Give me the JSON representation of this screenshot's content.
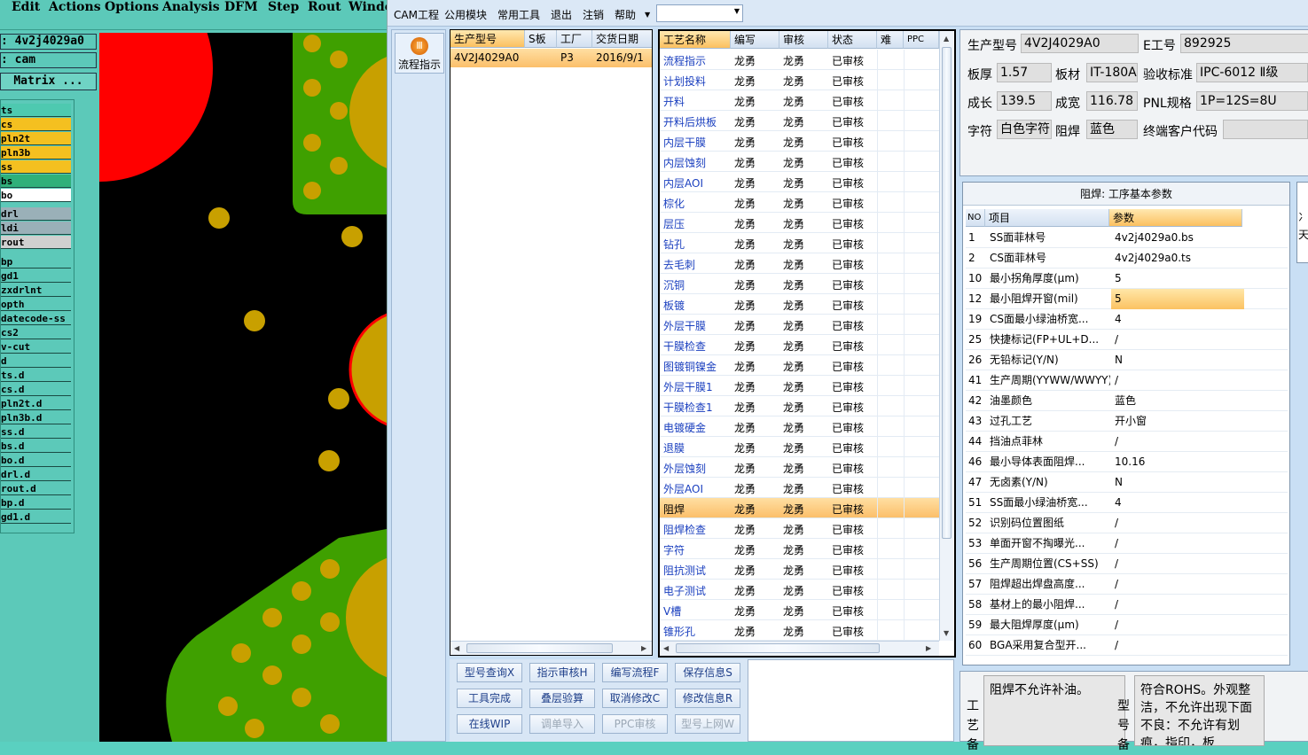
{
  "genesis": {
    "menu": [
      "Edit",
      "Actions",
      "Options",
      "Analysis",
      "DFM",
      "Step",
      "Rout",
      "Windo"
    ],
    "job": ": 4v2j4029a0",
    "step": ": cam",
    "matrix": "Matrix ...",
    "layers": [
      "ts",
      "cs",
      "pln2t",
      "pln3b",
      "ss",
      "bs",
      "bo",
      "drl",
      "ldi",
      "rout",
      "bp",
      "gd1",
      "zxdrlnt",
      "opth",
      "datecode-ss",
      "cs2",
      "v-cut",
      "d",
      "ts.d",
      "cs.d",
      "pln2t.d",
      "pln3b.d",
      "ss.d",
      "bs.d",
      "bo.d",
      "drl.d",
      "rout.d",
      "bp.d",
      "gd1.d"
    ],
    "colors": {
      "bg": "#5cc9b9",
      "copper": "#c8a000",
      "mask": "#3fa000",
      "red": "#ff0000",
      "board": "#000000"
    }
  },
  "app": {
    "menu": [
      "CAM工程",
      "公用模块",
      "常用工具",
      "退出",
      "注销",
      "帮助"
    ],
    "nav": {
      "flow_button": "流程指示",
      "icon": "flow-icon"
    },
    "orders": {
      "headers": [
        "生产型号",
        "S板",
        "工厂",
        "交货日期"
      ],
      "rows": [
        [
          "4V2J4029A0",
          "",
          "P3",
          "2016/9/1"
        ]
      ]
    },
    "processes": {
      "headers": [
        "工艺名称",
        "编写",
        "审核",
        "状态",
        "难",
        "PPC"
      ],
      "rows": [
        [
          "流程指示",
          "龙勇",
          "龙勇",
          "已审核"
        ],
        [
          "计划投料",
          "龙勇",
          "龙勇",
          "已审核"
        ],
        [
          "开料",
          "龙勇",
          "龙勇",
          "已审核"
        ],
        [
          "开料后烘板",
          "龙勇",
          "龙勇",
          "已审核"
        ],
        [
          "内层干膜",
          "龙勇",
          "龙勇",
          "已审核"
        ],
        [
          "内层蚀刻",
          "龙勇",
          "龙勇",
          "已审核"
        ],
        [
          "内层AOI",
          "龙勇",
          "龙勇",
          "已审核"
        ],
        [
          "棕化",
          "龙勇",
          "龙勇",
          "已审核"
        ],
        [
          "层压",
          "龙勇",
          "龙勇",
          "已审核"
        ],
        [
          "钻孔",
          "龙勇",
          "龙勇",
          "已审核"
        ],
        [
          "去毛刺",
          "龙勇",
          "龙勇",
          "已审核"
        ],
        [
          "沉铜",
          "龙勇",
          "龙勇",
          "已审核"
        ],
        [
          "板镀",
          "龙勇",
          "龙勇",
          "已审核"
        ],
        [
          "外层干膜",
          "龙勇",
          "龙勇",
          "已审核"
        ],
        [
          "干膜检查",
          "龙勇",
          "龙勇",
          "已审核"
        ],
        [
          "图镀铜镍金",
          "龙勇",
          "龙勇",
          "已审核"
        ],
        [
          "外层干膜1",
          "龙勇",
          "龙勇",
          "已审核"
        ],
        [
          "干膜检查1",
          "龙勇",
          "龙勇",
          "已审核"
        ],
        [
          "电镀硬金",
          "龙勇",
          "龙勇",
          "已审核"
        ],
        [
          "退膜",
          "龙勇",
          "龙勇",
          "已审核"
        ],
        [
          "外层蚀刻",
          "龙勇",
          "龙勇",
          "已审核"
        ],
        [
          "外层AOI",
          "龙勇",
          "龙勇",
          "已审核"
        ],
        [
          "阻焊",
          "龙勇",
          "龙勇",
          "已审核"
        ],
        [
          "阻焊检查",
          "龙勇",
          "龙勇",
          "已审核"
        ],
        [
          "字符",
          "龙勇",
          "龙勇",
          "已审核"
        ],
        [
          "阻抗测试",
          "龙勇",
          "龙勇",
          "已审核"
        ],
        [
          "电子测试",
          "龙勇",
          "龙勇",
          "已审核"
        ],
        [
          "V槽",
          "龙勇",
          "龙勇",
          "已审核"
        ],
        [
          "锥形孔",
          "龙勇",
          "龙勇",
          "已审核"
        ]
      ],
      "selected": "阻焊"
    },
    "info": {
      "model_label": "生产型号",
      "model": "4V2J4029A0",
      "e_label": "E工号",
      "e": "892925",
      "thick_label": "板厚",
      "thick": "1.57",
      "mat_label": "板材",
      "mat": "IT-180A",
      "std_label": "验收标准",
      "std": "IPC-6012 Ⅱ级",
      "len_label": "成长",
      "len": "139.5",
      "wid_label": "成宽",
      "wid": "116.78",
      "pnl_label": "PNL规格",
      "pnl": "1P=12S=8U",
      "char_label": "字符",
      "char": "白色字符",
      "mask_label": "阻焊",
      "mask": "蓝色",
      "cust_label": "终端客户代码",
      "cust": ""
    },
    "params": {
      "title": "阻焊: 工序基本参数",
      "headers": [
        "NO",
        "项目",
        "参数"
      ],
      "rows": [
        [
          "1",
          "SS面菲林号",
          "4v2j4029a0.bs"
        ],
        [
          "2",
          "CS面菲林号",
          "4v2j4029a0.ts"
        ],
        [
          "10",
          "最小拐角厚度(μm)",
          "5"
        ],
        [
          "12",
          "最小阻焊开窗(mil)",
          "5"
        ],
        [
          "19",
          "CS面最小绿油桥宽...",
          "4"
        ],
        [
          "25",
          "快捷标记(FP+UL+D...",
          "/"
        ],
        [
          "26",
          "无铅标记(Y/N)",
          "N"
        ],
        [
          "41",
          "生产周期(YYWW/WWYY)",
          "/"
        ],
        [
          "42",
          "油墨颜色",
          "蓝色"
        ],
        [
          "43",
          "过孔工艺",
          "开小窗"
        ],
        [
          "44",
          "挡油点菲林",
          "/"
        ],
        [
          "46",
          "最小导体表面阻焊...",
          "10.16"
        ],
        [
          "47",
          "无卤素(Y/N)",
          "N"
        ],
        [
          "51",
          "SS面最小绿油桥宽...",
          "4"
        ],
        [
          "52",
          "识别码位置图纸",
          "/"
        ],
        [
          "53",
          "单面开窗不掏曝光...",
          "/"
        ],
        [
          "56",
          "生产周期位置(CS+SS)",
          "/"
        ],
        [
          "57",
          "阻焊超出焊盘高度...",
          "/"
        ],
        [
          "58",
          "基材上的最小阻焊...",
          "/"
        ],
        [
          "59",
          "最大阻焊厚度(μm)",
          "/"
        ],
        [
          "60",
          "BGA采用复合型开...",
          "/"
        ]
      ],
      "selected_no": "12",
      "edge_text": [
        "冫",
        "天"
      ]
    },
    "buttons": [
      [
        "型号查询X",
        "指示审核H",
        "编写流程F",
        "保存信息S"
      ],
      [
        "工具完成",
        "叠层验算",
        "取消修改C",
        "修改信息R"
      ],
      [
        "在线WIP",
        "调单导入",
        "PPC审核",
        "型号上网W"
      ]
    ],
    "disabled_buttons": [
      "调单导入",
      "PPC审核",
      "型号上网W"
    ],
    "notes": {
      "proc_label": "工艺备",
      "proc_text": "阻焊不允许补油。",
      "model_label": "型号备",
      "model_text": "符合ROHS。外观整洁，不允许出现下面不良：不允许有划痕，指印，板"
    }
  }
}
